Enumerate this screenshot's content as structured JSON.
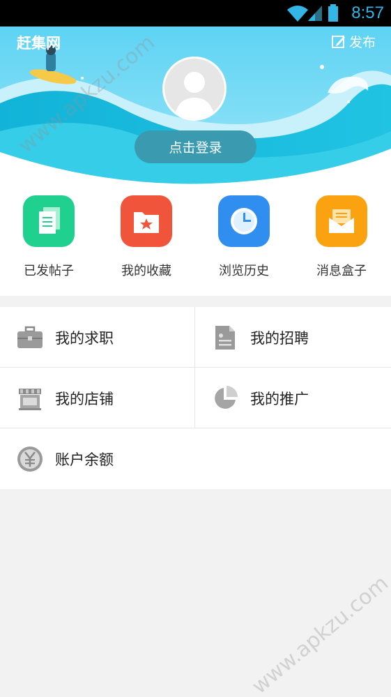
{
  "status_bar": {
    "time": "8:57"
  },
  "header": {
    "app_name": "赶集网",
    "publish_label": "发布",
    "login_label": "点击登录"
  },
  "quick_actions": [
    {
      "label": "已发帖子",
      "icon": "document-icon",
      "color": "#1fd08f"
    },
    {
      "label": "我的收藏",
      "icon": "folder-star-icon",
      "color": "#f0543a"
    },
    {
      "label": "浏览历史",
      "icon": "clock-icon",
      "color": "#2f8ef0"
    },
    {
      "label": "消息盒子",
      "icon": "envelope-icon",
      "color": "#fba210"
    }
  ],
  "menu": {
    "job_seeking": "我的求职",
    "recruiting": "我的招聘",
    "my_store": "我的店铺",
    "my_promotion": "我的推广",
    "account_balance": "账户余额"
  },
  "watermark": "www.apkzu.com"
}
